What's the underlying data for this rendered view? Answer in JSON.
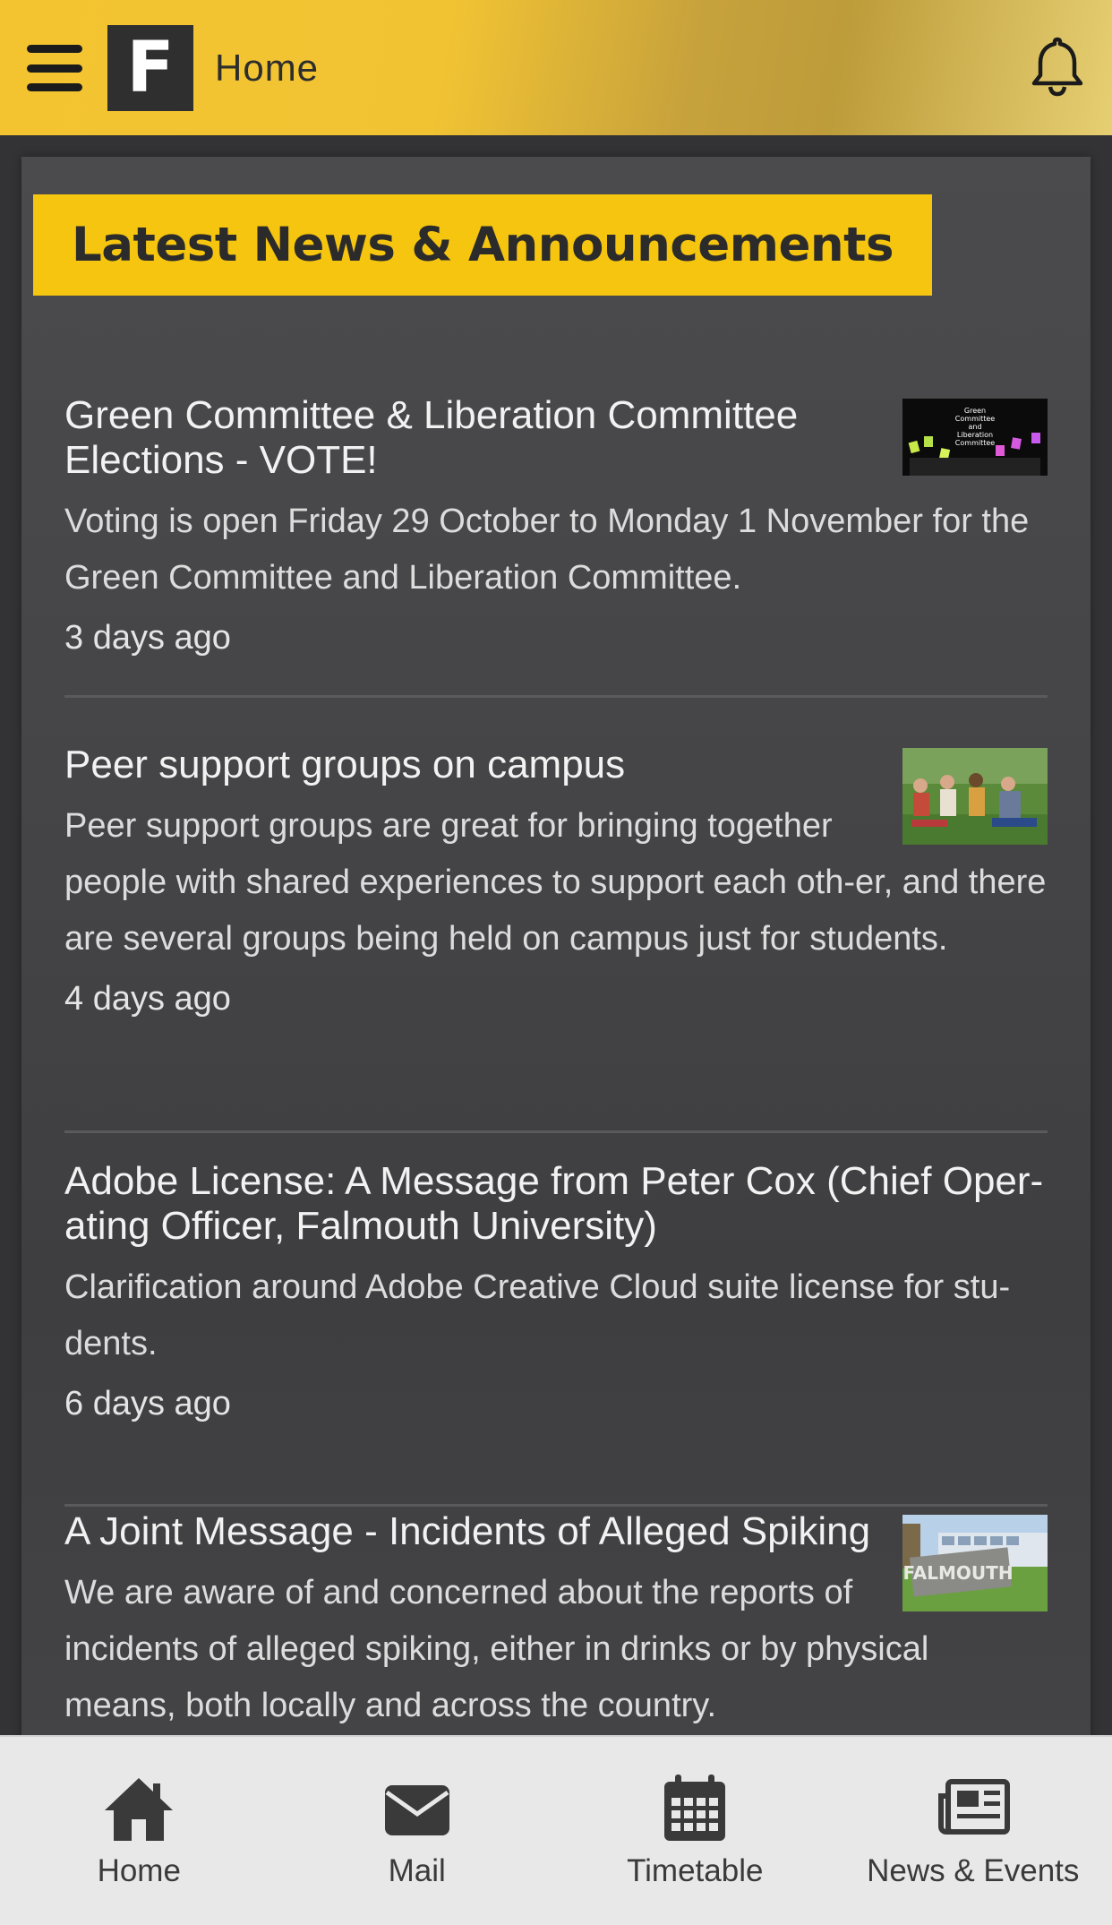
{
  "header": {
    "logo_letter": "F",
    "title": "Home"
  },
  "section": {
    "heading": "Latest News & Announcements"
  },
  "news": [
    {
      "title": "Green Committee & Liberation Committee Elections - VOTE!",
      "description": "Voting is open Friday 29 October to Monday 1 November for the Green Committee and Liberation Committee.",
      "time": "3 days ago",
      "thumb_text": "Green Committee and Liberation Committee"
    },
    {
      "title": "Peer support groups on campus",
      "description": "Peer support groups are great for bringing together people with shared experiences to support each oth-er, and there are several groups being held on campus just for students.",
      "time": "4 days ago"
    },
    {
      "title": "Adobe License: A Message from Peter Cox (Chief Oper-ating Officer, Falmouth University)",
      "description": "Clarification around Adobe Creative Cloud suite license for stu-dents.",
      "time": "6 days ago"
    },
    {
      "title": "A Joint Message - Incidents of Alleged Spiking",
      "description": "We are aware of and concerned about the reports of incidents of alleged spiking, either in drinks or by physical means, both locally and across the country.",
      "thumb_text": "FALMOUTH"
    }
  ],
  "bottom_nav": [
    {
      "label": "Home",
      "icon": "home-icon"
    },
    {
      "label": "Mail",
      "icon": "mail-icon"
    },
    {
      "label": "Timetable",
      "icon": "calendar-icon"
    },
    {
      "label": "News & Events",
      "icon": "newspaper-icon"
    }
  ],
  "colors": {
    "accent": "#f5c50f",
    "card_bg": "#444446",
    "nav_bg": "#e8e8e8"
  }
}
